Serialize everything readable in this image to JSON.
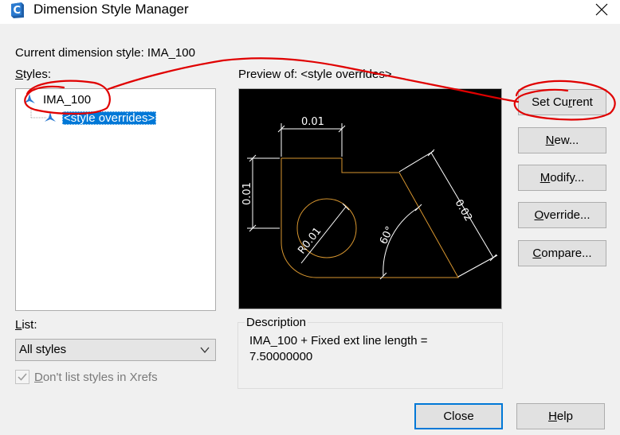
{
  "window": {
    "title": "Dimension Style Manager",
    "app_icon": "autocad-c-icon",
    "close_icon": "close-icon"
  },
  "current_style": {
    "label": "Current dimension style: IMA_100"
  },
  "styles": {
    "label_first": "S",
    "label_rest": "tyles:",
    "items": [
      {
        "label": "IMA_100",
        "icon": "dimension-style-icon",
        "selected": false
      },
      {
        "label": "<style overrides>",
        "icon": "dimension-style-icon",
        "selected": true
      }
    ]
  },
  "preview": {
    "label": "Preview of: <style overrides>",
    "dims": {
      "top": "0.01",
      "left": "0.01",
      "slant": "0.02",
      "radius": "R0.01",
      "angle": "60°"
    },
    "colors": {
      "background": "#000000",
      "geometry": "#d8962f",
      "dimension": "#ffffff"
    }
  },
  "list": {
    "label_first": "L",
    "label_rest": "ist:",
    "selected": "All styles"
  },
  "xrefs_checkbox": {
    "label_first": "D",
    "label_rest": "on't list styles in Xrefs",
    "checked": true,
    "enabled": false
  },
  "description": {
    "legend": "Description",
    "line1": "IMA_100 + Fixed ext line length =",
    "line2": "7.50000000"
  },
  "buttons": {
    "set_current": {
      "pre": "Set Cu",
      "ul": "r",
      "post": "rent"
    },
    "new": {
      "pre": "",
      "ul": "N",
      "post": "ew..."
    },
    "modify": {
      "pre": "",
      "ul": "M",
      "post": "odify..."
    },
    "override": {
      "pre": "",
      "ul": "O",
      "post": "verride..."
    },
    "compare": {
      "pre": "",
      "ul": "C",
      "post": "ompare..."
    },
    "close": {
      "label": "Close"
    },
    "help": {
      "pre": "",
      "ul": "H",
      "post": "elp"
    }
  },
  "accent_color": "#0078d7",
  "annotation_color": "#e00000"
}
